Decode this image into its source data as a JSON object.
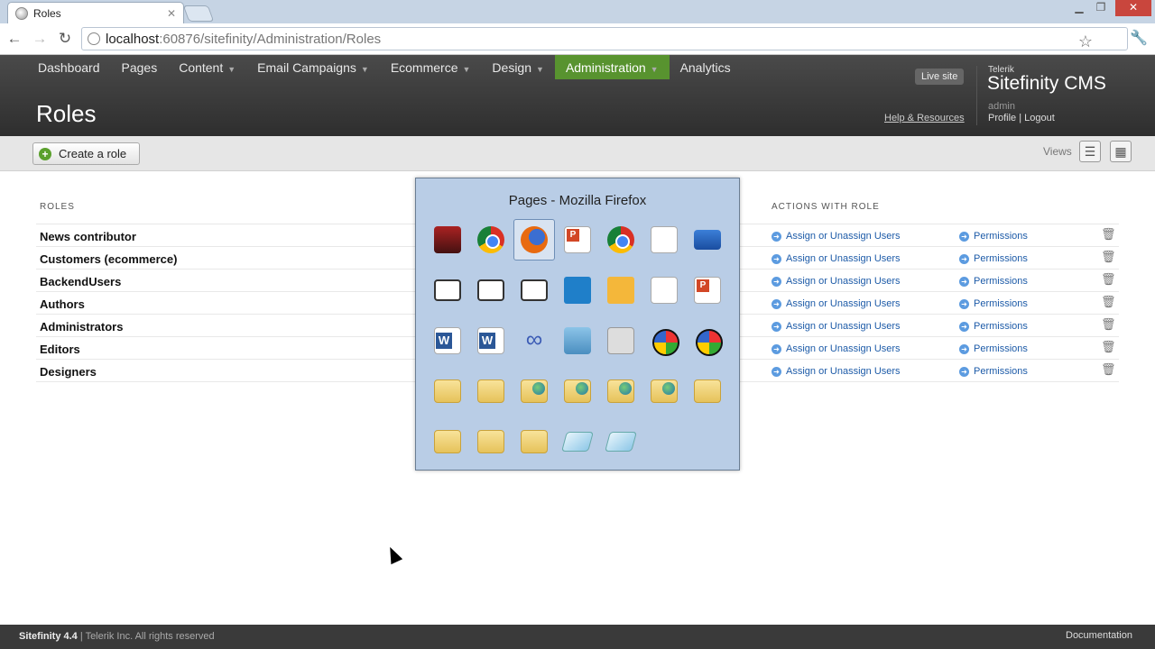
{
  "browser": {
    "tab_title": "Roles",
    "url_host": "localhost",
    "url_path": ":60876/sitefinity/Administration/Roles"
  },
  "nav": {
    "items": [
      {
        "label": "Dashboard",
        "has_caret": false,
        "active": false
      },
      {
        "label": "Pages",
        "has_caret": false,
        "active": false
      },
      {
        "label": "Content",
        "has_caret": true,
        "active": false
      },
      {
        "label": "Email Campaigns",
        "has_caret": true,
        "active": false
      },
      {
        "label": "Ecommerce",
        "has_caret": true,
        "active": false
      },
      {
        "label": "Design",
        "has_caret": true,
        "active": false
      },
      {
        "label": "Administration",
        "has_caret": true,
        "active": true
      },
      {
        "label": "Analytics",
        "has_caret": false,
        "active": false
      }
    ],
    "active_color": "#58932f"
  },
  "header": {
    "page_title": "Roles",
    "live_site": "Live site",
    "help_link": "Help & Resources",
    "brand_small": "Telerik",
    "brand_big": "Sitefinity CMS",
    "user": "admin",
    "user_links": "Profile | Logout"
  },
  "actionbar": {
    "create_role": "Create a role",
    "views_label": "Views"
  },
  "table": {
    "roles_header": "ROLES",
    "actions_header": "ACTIONS WITH ROLE",
    "assign_label": "Assign or Unassign Users",
    "permissions_label": "Permissions",
    "rows": [
      {
        "name": "News contributor"
      },
      {
        "name": "Customers (ecommerce)"
      },
      {
        "name": "BackendUsers"
      },
      {
        "name": "Authors"
      },
      {
        "name": "Administrators"
      },
      {
        "name": "Editors"
      },
      {
        "name": "Designers"
      }
    ]
  },
  "switcher": {
    "title": "Pages - Mozilla Firefox",
    "icons": [
      [
        "camera-icon",
        "chrome-icon",
        "firefox-icon",
        "powerpoint-doc-icon",
        "chrome-icon",
        "document-icon",
        "monitor-icon"
      ],
      [
        "chat-bubble-icon",
        "chat-bubble-icon",
        "chat-bubble-icon",
        "lync-icon",
        "outlook-icon",
        "document-icon",
        "powerpoint-icon"
      ],
      [
        "word-icon",
        "word-icon",
        "infinity-icon",
        "book-icon",
        "notebook-icon",
        "balls-icon",
        "balls-icon"
      ],
      [
        "folder-icon",
        "folder-icon",
        "globe-folder-icon",
        "globe-folder-icon",
        "globe-folder-icon",
        "globe-folder-icon",
        "folder-icon"
      ],
      [
        "folder-icon",
        "folder-icon",
        "folder-icon",
        "notepad-icon",
        "notepad-icon"
      ]
    ],
    "selected": "firefox-icon"
  },
  "footer": {
    "product": "Sitefinity 4.4",
    "copyright": " | Telerik Inc. All rights reserved",
    "documentation": "Documentation"
  }
}
